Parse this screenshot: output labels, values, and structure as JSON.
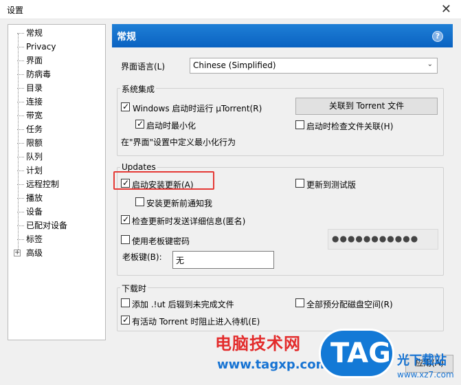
{
  "window": {
    "title": "设置",
    "close_glyph": "✕"
  },
  "tree": {
    "items": [
      {
        "label": "常规"
      },
      {
        "label": "Privacy"
      },
      {
        "label": "界面"
      },
      {
        "label": "防病毒"
      },
      {
        "label": "目录"
      },
      {
        "label": "连接"
      },
      {
        "label": "带宽"
      },
      {
        "label": "任务"
      },
      {
        "label": "限额"
      },
      {
        "label": "队列"
      },
      {
        "label": "计划"
      },
      {
        "label": "远程控制"
      },
      {
        "label": "播放"
      },
      {
        "label": "设备"
      },
      {
        "label": "已配对设备"
      },
      {
        "label": "标签"
      },
      {
        "label": "高级",
        "expander": "+"
      }
    ]
  },
  "panel": {
    "title": "常规",
    "help_glyph": "?",
    "language": {
      "label": "界面语言(L)",
      "value": "Chinese (Simplified)"
    },
    "system_integration": {
      "title": "系统集成",
      "run_on_startup": {
        "label": "Windows 启动时运行 µTorrent(R)",
        "checked": true
      },
      "start_minimized": {
        "label": "启动时最小化",
        "checked": true
      },
      "associate_button": "关联到 Torrent 文件",
      "check_assoc": {
        "label": "启动时检查文件关联(H)",
        "checked": false
      },
      "note": "在\"界面\"设置中定义最小化行为"
    },
    "updates": {
      "title": "Updates",
      "auto_install": {
        "label": "启动安装更新(A)",
        "checked": true
      },
      "beta": {
        "label": "更新到测试版",
        "checked": false
      },
      "notify_before": {
        "label": "安装更新前通知我",
        "checked": false
      },
      "send_info": {
        "label": "检查更新时发送详细信息(匿名)",
        "checked": true
      },
      "boss_password": {
        "label": "使用老板键密码",
        "checked": false
      },
      "password_value": "●●●●●●●●●●●",
      "boss_key_label": "老板键(B):",
      "boss_key_value": "无"
    },
    "downloads": {
      "title": "下载时",
      "append_ut": {
        "label": "添加 .!ut 后辍到未完成文件",
        "checked": false
      },
      "prealloc": {
        "label": "全部预分配磁盘空间(R)",
        "checked": false
      },
      "standby": {
        "label": "有活动 Torrent 时阻止进入待机(E)",
        "checked": true
      }
    }
  },
  "footer": {
    "apply_label": "应用(A)"
  },
  "watermark": {
    "site_name": "电脑技术网",
    "url": "www.tagxp.com",
    "tag": "TAG",
    "site_name2": "光下载站",
    "url2": "www.xz7.com"
  },
  "colors": {
    "header": "#0a62c1",
    "highlight": "#e53935"
  }
}
